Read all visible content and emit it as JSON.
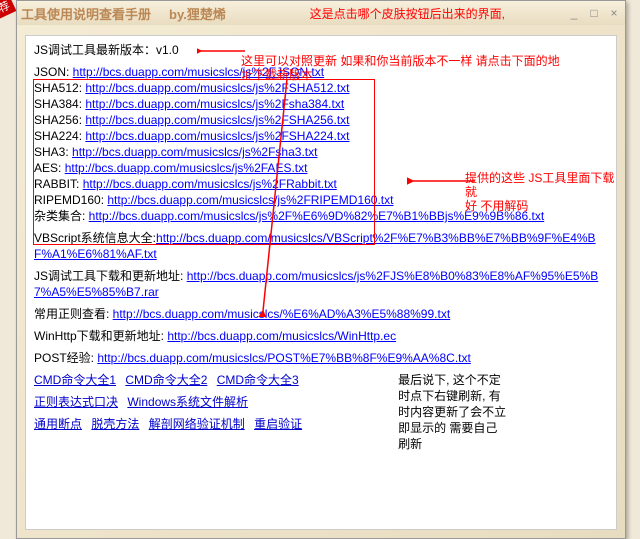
{
  "window": {
    "badge": "推荐",
    "title": "工具使用说明查看手册",
    "author": "by.狸楚烯"
  },
  "buttons": {
    "min": "_",
    "max": "□",
    "close": "×"
  },
  "version_line": "JS调试工具最新版本：v1.0",
  "annot": {
    "top": "这是点击哪个皮肤按钮后出来的界面,",
    "mid1": "这里可以对照更新 如果和你当前版本不一样 请点击下面的地",
    "mid2": "址下载新版本",
    "right1": "提供的这些 JS工具里面下载就",
    "right2": "好 不用解码"
  },
  "links": {
    "json": {
      "label": "JSON: ",
      "url": "http://bcs.duapp.com/musicslcs/js%2FJSON.txt"
    },
    "sha512": {
      "label": "SHA512: ",
      "url": "http://bcs.duapp.com/musicslcs/js%2FSHA512.txt"
    },
    "sha384": {
      "label": "SHA384: ",
      "url": "http://bcs.duapp.com/musicslcs/js%2Fsha384.txt"
    },
    "sha256": {
      "label": "SHA256: ",
      "url": "http://bcs.duapp.com/musicslcs/js%2FSHA256.txt"
    },
    "sha224": {
      "label": "SHA224: ",
      "url": "http://bcs.duapp.com/musicslcs/js%2FSHA224.txt"
    },
    "sha3": {
      "label": "SHA3: ",
      "url": "http://bcs.duapp.com/musicslcs/js%2Fsha3.txt"
    },
    "aes": {
      "label": "AES: ",
      "url": "http://bcs.duapp.com/musicslcs/js%2FAES.txt"
    },
    "rabbit": {
      "label": "RABBIT: ",
      "url": "http://bcs.duapp.com/musicslcs/js%2FRabbit.txt"
    },
    "ripemd160": {
      "label": "RIPEMD160: ",
      "url": "http://bcs.duapp.com/musicslcs/js%2FRIPEMD160.txt"
    },
    "misc": {
      "label": "杂类集合: ",
      "url": "http://bcs.duapp.com/musicslcs/js%2F%E6%9D%82%E7%B1%BBjs%E9%9B%86.txt"
    }
  },
  "vbs": {
    "label": "VBScript系统信息大全:",
    "url": "http://bcs.duapp.com/musicslcs/VBScript%2F%E7%B3%BB%E7%BB%9F%E4%BF%A1%E6%81%AF.txt"
  },
  "dltools": {
    "label": "JS调试工具下载和更新地址: ",
    "url": "http://bcs.duapp.com/musicslcs/js%2FJS%E8%B0%83%E8%AF%95%E5%B7%A5%E5%85%B7.rar"
  },
  "regex": {
    "label": "常用正则查看: ",
    "url": "http://bcs.duapp.com/musicslcs/%E6%AD%A3%E5%88%99.txt"
  },
  "winhttp": {
    "label": "WinHttp下载和更新地址: ",
    "url": "http://bcs.duapp.com/musicslcs/WinHttp.ec"
  },
  "post": {
    "label": "POST经验: ",
    "url": "http://bcs.duapp.com/musicslcs/POST%E7%BB%8F%E9%AA%8C.txt"
  },
  "cmds": {
    "c1": "CMD命令大全1",
    "c2": "CMD命令大全2",
    "c3": "CMD命令大全3",
    "r1": "正则表达式口决",
    "r2": "Windows系统文件解析",
    "r3a": "通用断点",
    "r3b": "脱壳方法",
    "r3c": "解剖网络验证机制",
    "r3d": "重启验证"
  },
  "final": {
    "l1": "最后说下, 这个不定",
    "l2": "时点下右键刷新, 有",
    "l3": "时内容更新了会不立",
    "l4": "即显示的 需要自己",
    "l5": "刷新"
  }
}
